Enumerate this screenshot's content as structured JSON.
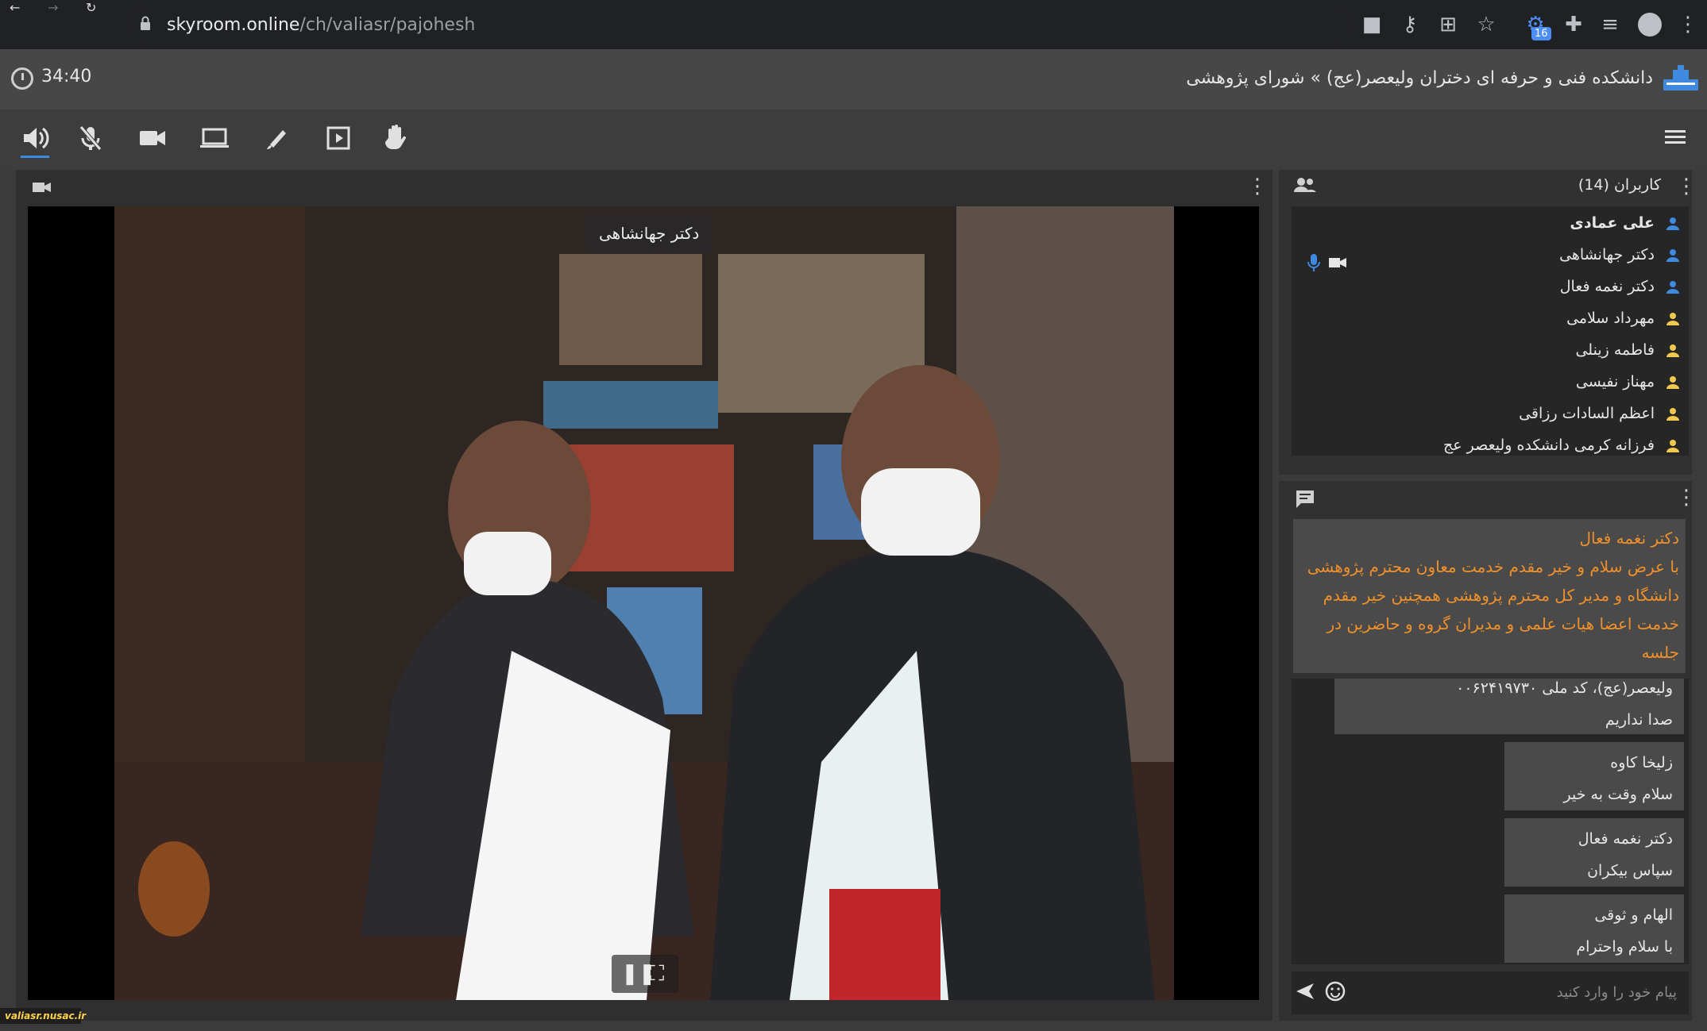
{
  "browser": {
    "url_host": "skyroom.online",
    "url_path": "/ch/valiasr/pajohesh",
    "extension_badge": "16"
  },
  "header": {
    "timer": "34:40",
    "room_title": "دانشکده فنی و حرفه ای دختران ولیعصر(عج) » شورای پژوهشی"
  },
  "toolbar": {
    "tools": [
      "speaker-icon",
      "mic-off-icon",
      "camera-icon",
      "screen-share-icon",
      "pen-icon",
      "media-icon",
      "raise-hand-icon"
    ]
  },
  "video": {
    "speaker_name": "دکتر جهانشاهی"
  },
  "users": {
    "title": "کاربران (14)",
    "items": [
      {
        "name": "علی عمادی",
        "bold": true,
        "color": "#3f8ae0"
      },
      {
        "name": "دکتر جهانشاهی",
        "bold": false,
        "color": "#3f8ae0"
      },
      {
        "name": "دکتر نغمه فعال",
        "bold": false,
        "color": "#3f8ae0"
      },
      {
        "name": "مهرداد سلامی",
        "bold": false,
        "color": "#f2c94c"
      },
      {
        "name": "فاطمه زینلی",
        "bold": false,
        "color": "#f2c94c"
      },
      {
        "name": "مهناز نفیسی",
        "bold": false,
        "color": "#f2c94c"
      },
      {
        "name": "اعظم السادات رزاقی",
        "bold": false,
        "color": "#f2c94c"
      },
      {
        "name": "فرزانه کرمی دانشکده ولیعصر عج",
        "bold": false,
        "color": "#f2c94c"
      }
    ]
  },
  "chat": {
    "pinned_author": "دکتر نغمه فعال",
    "pinned_text": "با عرض سلام و خیر مقدم خدمت معاون محترم پژوهشی دانشگاه و مدیر کل محترم پژوهشی همچنین خیر مقدم خدمت اعضا هیات علمی و مدیران گروه و حاضرین  در جلسه",
    "messages": [
      {
        "author": "ولیعصر(عج)، کد ملی ۰۰۶۲۴۱۹۷۳۰",
        "text": "صدا نداریم"
      },
      {
        "author": "زلیخا کاوه",
        "text": "سلام وقت به خیر"
      },
      {
        "author": "دکتر نغمه فعال",
        "text": "سپاس بیکران"
      },
      {
        "author": "الهام و ثوقی",
        "text": "با سلام واحترام"
      }
    ],
    "input_placeholder": "پیام خود را وارد کنید"
  },
  "watermark": "valiasr.nusac.ir",
  "colors": {
    "accent": "#3f8ae0",
    "pinned_text": "#f0902a"
  }
}
